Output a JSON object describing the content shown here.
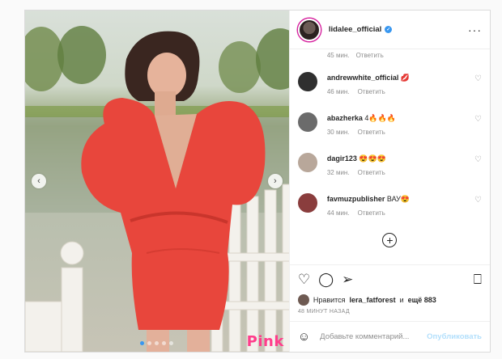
{
  "post": {
    "username": "lidalee_official",
    "more_icon": "more-icon",
    "watermark": "Pink",
    "carousel": {
      "dots": 5,
      "active_index": 0
    }
  },
  "top_meta": {
    "time": "45 мин.",
    "reply": "Ответить"
  },
  "comments": [
    {
      "user": "andrewwhite_official",
      "text": "💋",
      "time": "46 мин.",
      "reply": "Ответить",
      "avatar_color": "#2f2f2f"
    },
    {
      "user": "abazherka",
      "text": "4🔥🔥🔥",
      "time": "30 мин.",
      "reply": "Ответить",
      "avatar_color": "#6b6b6b"
    },
    {
      "user": "dagir123",
      "text": "😍😍😍",
      "time": "32 мин.",
      "reply": "Ответить",
      "avatar_color": "#b8a79a"
    },
    {
      "user": "favmuzpublisher",
      "text": "ВАУ😍",
      "time": "44 мин.",
      "reply": "Ответить",
      "avatar_color": "#8a3d3d"
    }
  ],
  "likes": {
    "prefix": "Нравится",
    "user": "lera_fatforest",
    "middle": "и",
    "count": "ещё 883"
  },
  "timestamp": "48 МИНУТ НАЗАД",
  "add_comment": {
    "placeholder": "Добавьте комментарий...",
    "publish_label": "Опубликовать"
  },
  "icons": {
    "heart": "♡",
    "comment": "◯",
    "share": "➢",
    "bookmark": "⎕",
    "emoji": "☺",
    "plus": "+",
    "left": "‹",
    "right": "›"
  },
  "colors": {
    "accent": "#3897f0",
    "publish_disabled": "#b2dffc",
    "watermark": "#ff3d8b"
  }
}
